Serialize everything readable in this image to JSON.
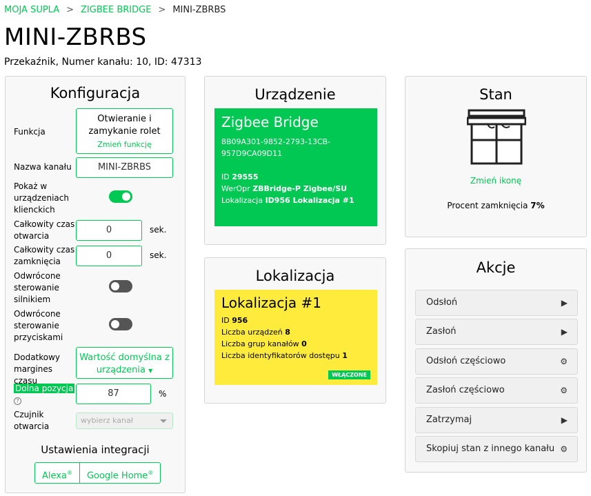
{
  "breadcrumb": {
    "root": "MOJA SUPLA",
    "parent": "ZIGBEE BRIDGE",
    "current": "MINI-ZBRBS",
    "separator": ">"
  },
  "page": {
    "title": "MINI-ZBRBS",
    "subtitle": "Przekaźnik, Numer kanału: 10, ID: 47313"
  },
  "config": {
    "title": "Konfiguracja",
    "function_label": "Funkcja",
    "function_value": "Otwieranie i zamykanie rolet",
    "function_change": "Zmień funkcję",
    "name_label": "Nazwa kanału",
    "name_value": "MINI-ZBRBS",
    "show_label": "Pokaż w urządzeniach klienckich",
    "show_on": true,
    "open_time_label": "Całkowity czas otwarcia",
    "open_time_value": "0",
    "close_time_label": "Całkowity czas zamknięcia",
    "close_time_value": "0",
    "time_unit": "sek.",
    "invert_motor_label": "Odwrócone sterowanie silnikiem",
    "invert_motor_on": false,
    "invert_buttons_label": "Odwrócone sterowanie przyciskami",
    "invert_buttons_on": false,
    "margin_label": "Dodatkowy margines czasu",
    "margin_value": "Wartość domyślna z urządzenia",
    "bottom_label": "Dolna pozycja",
    "bottom_value": "87",
    "bottom_unit": "%",
    "help_icon": "?",
    "sensor_label": "Czujnik otwarcia",
    "sensor_placeholder": "wybierz kanał",
    "integrations_title": "Ustawienia integracji",
    "alexa": "Alexa",
    "google": "Google Home",
    "registered_mark": "®"
  },
  "device": {
    "title": "Urządzenie",
    "name": "Zigbee Bridge",
    "guid": "8B09A301-9852-2793-13CB-957D9CA09D11",
    "id_label": "ID",
    "id_value": "29555",
    "soft_label": "WerOpr",
    "soft_value": "ZBBridge-P Zigbee/SU",
    "loc_label": "Lokalizacja",
    "loc_value": "ID956 Lokalizacja #1",
    "card_color": "#00c853"
  },
  "location": {
    "title": "Lokalizacja",
    "name": "Lokalizacja #1",
    "id_label": "ID",
    "id_value": "956",
    "devices_label": "Liczba urządzeń",
    "devices_value": "8",
    "groups_label": "Liczba grup kanałów",
    "groups_value": "0",
    "ids_label": "Liczba identyfikatorów dostępu",
    "ids_value": "1",
    "badge": "WŁĄCZONE",
    "card_color": "#ffeb3b"
  },
  "state": {
    "title": "Stan",
    "icon": "roller-shutter-icon",
    "change_icon": "Zmień ikonę",
    "percent_label": "Procent zamknięcia",
    "percent_value": "7%"
  },
  "actions": {
    "title": "Akcje",
    "items": [
      {
        "label": "Odsłoń",
        "icon": "play-icon"
      },
      {
        "label": "Zasłoń",
        "icon": "play-icon"
      },
      {
        "label": "Odsłoń częściowo",
        "icon": "gear-icon"
      },
      {
        "label": "Zasłoń częściowo",
        "icon": "gear-icon"
      },
      {
        "label": "Zatrzymaj",
        "icon": "play-icon"
      },
      {
        "label": "Skopiuj stan z innego kanału",
        "icon": "gear-icon"
      }
    ]
  },
  "colors": {
    "accent": "#00c853",
    "location": "#ffeb3b",
    "toggle_off": "#555555"
  }
}
